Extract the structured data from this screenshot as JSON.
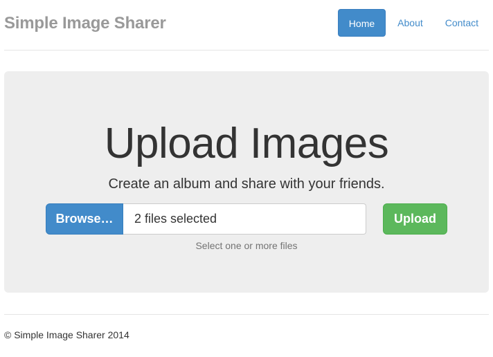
{
  "header": {
    "brand": "Simple Image Sharer",
    "nav": [
      {
        "label": "Home",
        "active": true
      },
      {
        "label": "About",
        "active": false
      },
      {
        "label": "Contact",
        "active": false
      }
    ]
  },
  "jumbotron": {
    "title": "Upload Images",
    "subtitle": "Create an album and share with your friends.",
    "browse_label": "Browse…",
    "file_field_value": "2 files selected",
    "upload_label": "Upload",
    "help_text": "Select one or more files"
  },
  "footer": {
    "text": "© Simple Image Sharer 2014"
  },
  "colors": {
    "primary": "#428bca",
    "success": "#5cb85c",
    "jumbotron_bg": "#eeeeee",
    "brand_text": "#999999"
  }
}
